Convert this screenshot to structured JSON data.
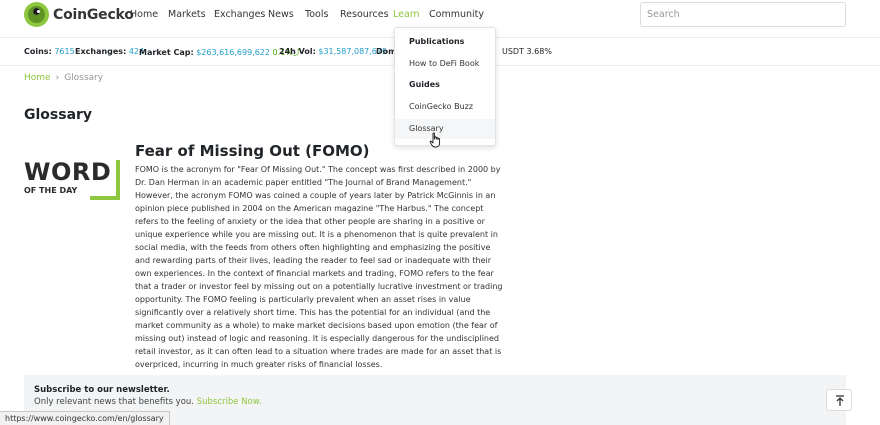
{
  "brand": {
    "name": "CoinGecko",
    "logo_color": "#8dc63f"
  },
  "nav": {
    "items": [
      "Home",
      "Markets",
      "Exchanges",
      "News",
      "Tools",
      "Resources",
      "Learn",
      "Community"
    ],
    "active": "Learn",
    "search_placeholder": "Search"
  },
  "stats": {
    "coins_label": "Coins:",
    "coins_value": "7615",
    "exchanges_label": "Exchanges:",
    "exchanges_value": "424",
    "market_cap_label": "Market Cap:",
    "market_cap_value": "$263,616,699,622",
    "market_cap_change": "0.1%",
    "vol_label": "24h Vol:",
    "vol_value": "$31,587,087,675",
    "dom_label": "Dom",
    "usdt": "USDT 3.68%"
  },
  "dropdown": {
    "section1": "Publications",
    "item1": "How to DeFi Book",
    "section2": "Guides",
    "item2": "CoinGecko Buzz",
    "item3": "Glossary"
  },
  "breadcrumb": {
    "home": "Home",
    "current": "Glossary"
  },
  "page_title": "Glossary",
  "word_of_day": {
    "word": "WORD",
    "sub": "OF THE DAY"
  },
  "term": {
    "title": "Fear of Missing Out (FOMO)",
    "body": "FOMO is the acronym for \"Fear Of Missing Out.\" The concept was first described in 2000 by Dr. Dan Herman in an academic paper entitled \"The Journal of Brand Management.\" However, the acronym FOMO was coined a couple of years later by Patrick McGinnis in an opinion piece published in 2004 on the American magazine \"The Harbus.\" The concept refers to the feeling of anxiety or the idea that other people are sharing in a positive or unique experience while you are missing out. It is a phenomenon that is quite prevalent in social media, with the feeds from others often highlighting and emphasizing the positive and rewarding parts of their lives, leading the reader to feel sad or inadequate with their own experiences. In the context of financial markets and trading, FOMO refers to the fear that a trader or investor feel by missing out on a potentially lucrative investment or trading opportunity. The FOMO feeling is particularly prevalent when an asset rises in value significantly over a relatively short time. This has the potential for an individual (and the market community as a whole) to make market decisions based upon emotion (the fear of missing out) instead of logic and reasoning. It is especially dangerous for the undisciplined retail investor, as it can often lead to a situation where trades are made for an asset that is overpriced, incurring in much greater risks of financial losses."
  },
  "newsletter": {
    "title": "Subscribe to our newsletter.",
    "text": "Only relevant news that benefits you.",
    "link": "Subscribe Now."
  },
  "status_url": "https://www.coingecko.com/en/glossary"
}
